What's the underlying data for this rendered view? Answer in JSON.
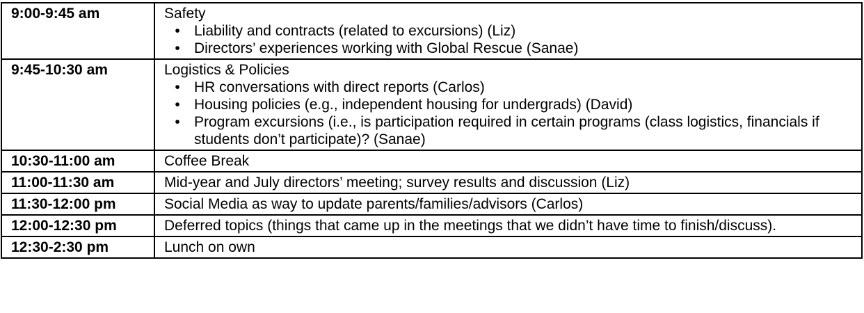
{
  "schedule": {
    "rows": [
      {
        "time": "9:00-9:45 am",
        "topic": "Safety",
        "bullets": [
          "Liability and contracts (related to excursions) (Liz)",
          "Directors’ experiences working with Global Rescue (Sanae)"
        ]
      },
      {
        "time": "9:45-10:30 am",
        "topic": "Logistics & Policies",
        "bullets": [
          "HR conversations with direct reports (Carlos)",
          "Housing policies (e.g., independent housing for undergrads) (David)",
          "Program excursions (i.e., is participation required in certain programs (class logistics, financials if students don’t participate)? (Sanae)"
        ]
      },
      {
        "time": "10:30-11:00 am",
        "topic": "Coffee Break",
        "bullets": []
      },
      {
        "time": "11:00-11:30 am",
        "topic": "Mid-year and July directors’ meeting; survey results and discussion (Liz)",
        "bullets": []
      },
      {
        "time": "11:30-12:00 pm",
        "topic": "Social Media as way to update parents/families/advisors (Carlos)",
        "bullets": []
      },
      {
        "time": "12:00-12:30 pm",
        "topic": "Deferred topics (things that came up in the meetings that we didn’t have time to finish/discuss).",
        "bullets": []
      },
      {
        "time": "12:30-2:30 pm",
        "topic": "Lunch on own",
        "bullets": []
      }
    ]
  }
}
